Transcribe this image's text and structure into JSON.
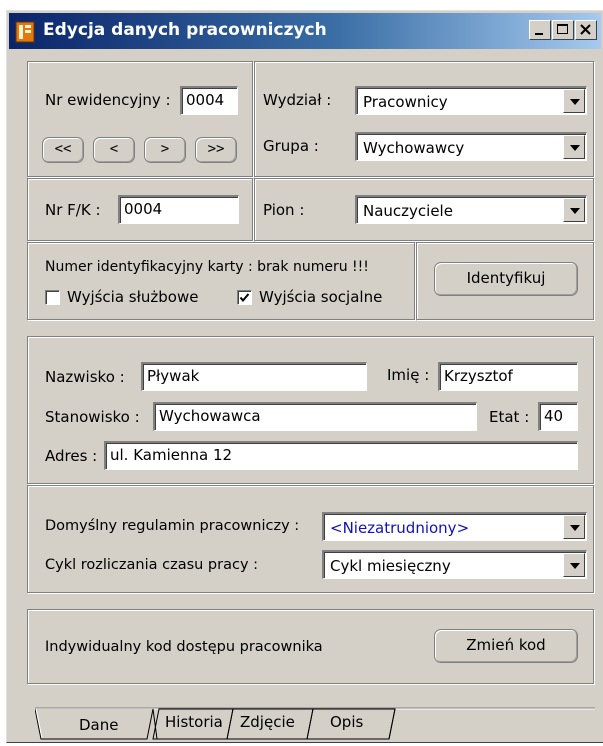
{
  "window": {
    "title": "Edycja danych pracowniczych"
  },
  "record": {
    "nr_ewid_label": "Nr ewidencyjny :",
    "nr_ewid_value": "0004",
    "nav": [
      "<<",
      "<",
      ">",
      ">>"
    ],
    "wydzial_label": "Wydział :",
    "wydzial_value": "Pracownicy",
    "grupa_label": "Grupa :",
    "grupa_value": "Wychowawcy",
    "nrfk_label": "Nr F/K :",
    "nrfk_value": "0004",
    "pion_label": "Pion :",
    "pion_value": "Nauczyciele"
  },
  "card": {
    "text": "Numer identyfikacyjny karty :  brak numeru !!!",
    "chk_sluzbowe_label": "Wyjścia służbowe",
    "chk_socjalne_label": "Wyjścia socjalne",
    "identify_button": "Identyfikuj"
  },
  "checkboxes": {
    "sluzbowe_checked": false,
    "socjalne_checked": true
  },
  "person": {
    "nazwisko_label": "Nazwisko :",
    "nazwisko_value": "Pływak",
    "imie_label": "Imię :",
    "imie_value": "Krzysztof",
    "stanowisko_label": "Stanowisko :",
    "stanowisko_value": "Wychowawca",
    "etat_label": "Etat :",
    "etat_value": "40",
    "adres_label": "Adres :",
    "adres_value": "ul. Kamienna 12"
  },
  "settings": {
    "regulamin_label": "Domyślny regulamin pracowniczy :",
    "regulamin_value": "<Niezatrudniony>",
    "cykl_label": "Cykl rozliczania czasu pracy :",
    "cykl_value": "Cykl miesięczny"
  },
  "access": {
    "text": "Indywidualny kod dostępu pracownika",
    "button": "Zmień kod"
  },
  "tabs": [
    "Dane",
    "Historia",
    "Zdjęcie",
    "Opis"
  ],
  "colors": {
    "title_start": "#0a246a",
    "title_end": "#a6caf0",
    "face": "#d4d0c8",
    "regulamin_text": "#1010c0"
  }
}
